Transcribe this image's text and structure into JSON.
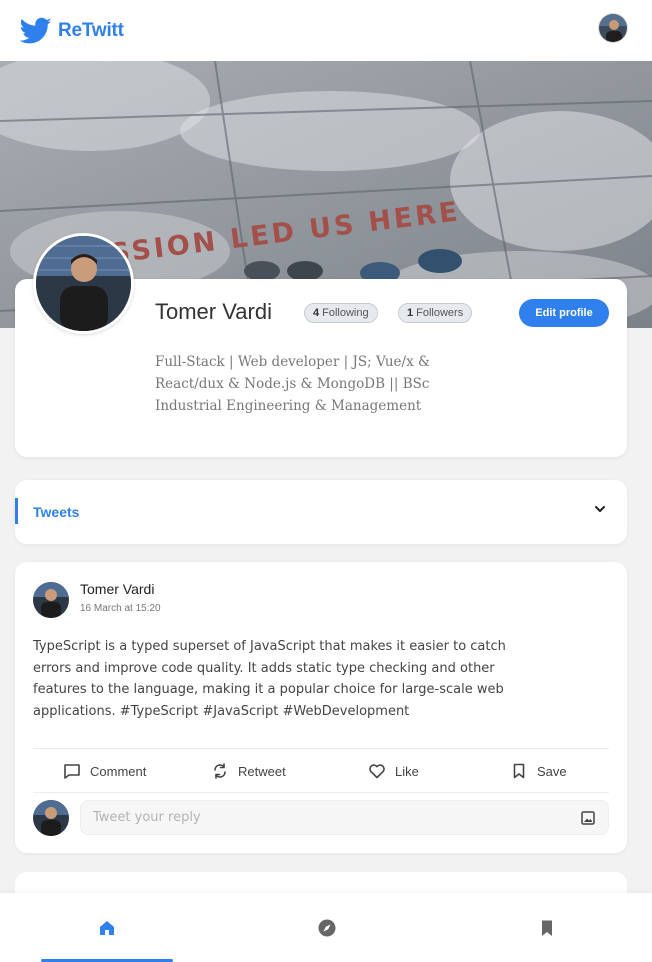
{
  "app": {
    "name": "ReTwitt",
    "accent": "#2f80ed",
    "logo_icon": "bird-icon"
  },
  "cover": {
    "image": "cover-photo",
    "text": "PASSION LED US HERE"
  },
  "profile": {
    "name": "Tomer Vardi",
    "following_count": "4",
    "following_label": "Following",
    "followers_count": "1",
    "followers_label": "Followers",
    "edit_label": "Edit profile",
    "bio": "Full-Stack | Web developer | JS; Vue/x & React/dux & Node.js & MongoDB || BSc Industrial Engineering & Management"
  },
  "tabs": {
    "active_label": "Tweets",
    "chevron_icon": "chevron-down-icon"
  },
  "tweet": {
    "author": "Tomer Vardi",
    "time": "16 March at 15:20",
    "text": "TypeScript is a typed superset of JavaScript that makes it easier to catch errors and improve code quality. It adds static type checking and other features to the language, making it a popular choice for large-scale web applications. #TypeScript #JavaScript #WebDevelopment",
    "actions": [
      {
        "label": "Comment",
        "icon": "comment-icon"
      },
      {
        "label": "Retweet",
        "icon": "retweet-icon"
      },
      {
        "label": "Like",
        "icon": "heart-icon"
      },
      {
        "label": "Save",
        "icon": "bookmark-icon"
      }
    ],
    "reply_placeholder": "Tweet your reply",
    "reply_value": ""
  },
  "bottom_nav": {
    "items": [
      {
        "icon": "home-icon",
        "active": true
      },
      {
        "icon": "compass-icon",
        "active": false
      },
      {
        "icon": "bookmark-icon",
        "active": false
      }
    ]
  }
}
